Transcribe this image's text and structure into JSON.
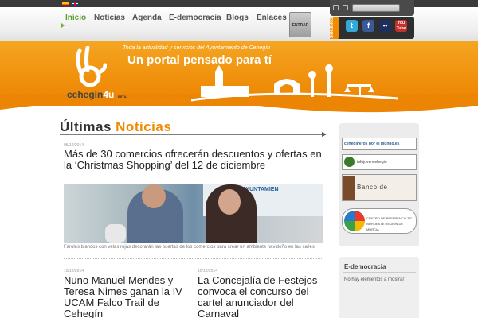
{
  "nav": {
    "items": [
      {
        "label": "Inicio"
      },
      {
        "label": "Noticias"
      },
      {
        "label": "Agenda"
      },
      {
        "label": "E-democracia"
      },
      {
        "label": "Blogs"
      },
      {
        "label": "Enlaces"
      }
    ],
    "enter_label": "ENTRAR"
  },
  "social": {
    "tab_label": "SIGUENOS",
    "twitter": "t",
    "facebook": "f",
    "flickr": "••",
    "youtube": "You Tube"
  },
  "banner": {
    "tagline": "Toda la actualidad y servicios del Ayuntamiento de Cehegín",
    "title": "Un portal pensado para tí",
    "logo_main": "cehegín",
    "logo_suffix": "4u",
    "logo_beta": "BETA"
  },
  "main": {
    "section_title_a": "Últimas",
    "section_title_b": "Noticias",
    "lead": {
      "date": "05/12/2014",
      "headline": "Más de 30 comercios ofrecerán descuentos y ofertas en la ‘Christmas Shopping’ del 12 de diciembre",
      "caption": "Faroles blancos con velas rojas decorarán las puertas de los comercios para crear un ambiente navideño en las calles",
      "photo_sign": "AYUNTAMIEN"
    },
    "news": [
      {
        "date": "10/12/2014",
        "headline": "Nuno Manuel Mendes y Teresa Nimes ganan la IV UCAM Falco Trail de Cehegín"
      },
      {
        "date": "10/12/2014",
        "headline": "La Concejalía de Festejos convoca el concurso del cartel anunciador del Carnaval"
      }
    ]
  },
  "sidebar": {
    "banners": [
      {
        "label": "cehegineros por el mundo.es"
      },
      {
        "label": "infojovencehegin"
      },
      {
        "label": "Banco de Memoria"
      },
      {
        "label": "CENTRO DE REFERENCIA TIC NOROESTE REGIÓN DE MURCIA"
      }
    ],
    "panel_title": "E-democracia",
    "panel_text": "No hay elementos a mostrar"
  },
  "colors": {
    "accent": "#f08a00",
    "nav_active": "#5a9e2b",
    "text": "#222222"
  }
}
